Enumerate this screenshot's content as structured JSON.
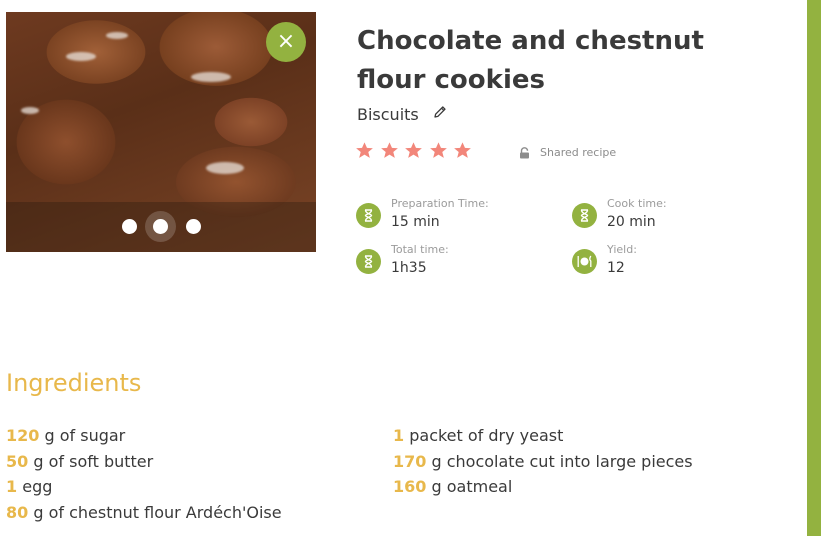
{
  "recipe": {
    "title": "Chocolate and chestnut flour cookies",
    "category": "Biscuits",
    "rating": 5,
    "rating_max": 5,
    "shared_label": "Shared recipe",
    "carousel": {
      "slides": 3,
      "active_index": 1
    },
    "close_icon": "close-icon",
    "colors": {
      "accent_green": "#93b240",
      "accent_gold": "#e8b84b",
      "star": "#f2867a"
    }
  },
  "meta": {
    "prep": {
      "label": "Preparation Time:",
      "value": "15 min",
      "icon": "hourglass-icon"
    },
    "cook": {
      "label": "Cook time:",
      "value": "20 min",
      "icon": "hourglass-icon"
    },
    "total": {
      "label": "Total time:",
      "value": "1h35",
      "icon": "hourglass-icon"
    },
    "yield": {
      "label": "Yield:",
      "value": "12",
      "icon": "plate-cutlery-icon"
    }
  },
  "ingredients": {
    "title": "Ingredients",
    "left": [
      {
        "qty": "120",
        "text": " g of sugar"
      },
      {
        "qty": "50",
        "text": " g of soft butter"
      },
      {
        "qty": "1",
        "text": " egg"
      },
      {
        "qty": "80",
        "text": " g of chestnut flour Ardéch'Oise"
      }
    ],
    "right": [
      {
        "qty": "1",
        "text": " packet of dry yeast"
      },
      {
        "qty": "170",
        "text": " g chocolate cut into large pieces"
      },
      {
        "qty": "160",
        "text": " g oatmeal"
      }
    ]
  }
}
